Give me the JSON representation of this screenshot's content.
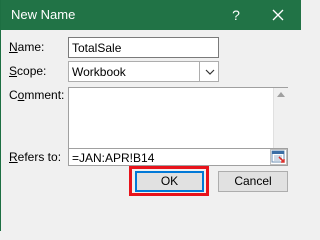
{
  "window": {
    "title": "New Name",
    "help_label": "?",
    "close_icon": "close-icon",
    "colors": {
      "titlebar": "#217346",
      "highlight": "#e8131b",
      "focus": "#0078d7"
    }
  },
  "form": {
    "name_label_accel": "N",
    "name_label_rest": "ame:",
    "name_value": "TotalSale",
    "scope_label_accel": "S",
    "scope_label_rest": "cope:",
    "scope_value": "Workbook",
    "comment_label_pre": "C",
    "comment_label_accel": "o",
    "comment_label_rest": "mment:",
    "comment_value": "",
    "refers_label_accel": "R",
    "refers_label_rest": "efers to:",
    "refers_value": "=JAN:APR!B14"
  },
  "buttons": {
    "ok_label": "OK",
    "cancel_label": "Cancel"
  }
}
